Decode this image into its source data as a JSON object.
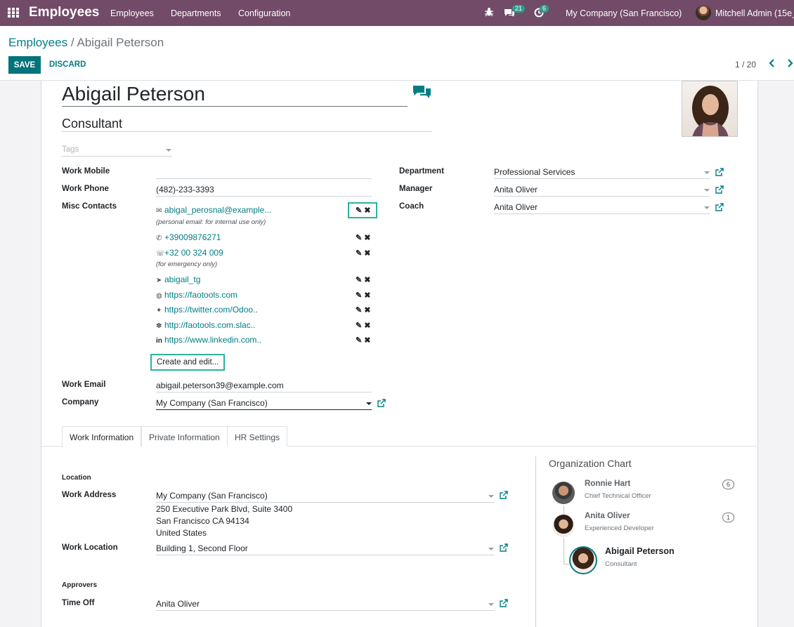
{
  "navbar": {
    "brand": "Employees",
    "menu": [
      "Employees",
      "Departments",
      "Configuration"
    ],
    "messages_count": "21",
    "activities_count": "6",
    "company": "My Company (San Francisco)",
    "user": "Mitchell Admin (15e_"
  },
  "control": {
    "breadcrumb_parent": "Employees",
    "breadcrumb_sep": "/",
    "breadcrumb_current": "Abigail Peterson",
    "save_label": "SAVE",
    "discard_label": "DISCARD",
    "pager": "1 / 20"
  },
  "employee": {
    "name": "Abigail Peterson",
    "job_title": "Consultant",
    "tags_placeholder": "Tags"
  },
  "left_fields": {
    "work_mobile_label": "Work Mobile",
    "work_mobile": "",
    "work_phone_label": "Work Phone",
    "work_phone": "(482)-233-3393",
    "misc_contacts_label": "Misc Contacts",
    "work_email_label": "Work Email",
    "work_email": "abigail.peterson39@example.com",
    "company_label": "Company",
    "company": "My Company (San Francisco)"
  },
  "contacts": [
    {
      "icon": "email-icon",
      "glyph": "✉",
      "value": "abigal_perosnal@example...",
      "note": "(personal email: for internal use only)"
    },
    {
      "icon": "whatsapp-icon",
      "glyph": "✆",
      "value": "+39009876271",
      "note": ""
    },
    {
      "icon": "phone-icon",
      "glyph": "☏",
      "value": "+32 00 324 009",
      "note": "(for emergency only)"
    },
    {
      "icon": "telegram-icon",
      "glyph": "➤",
      "value": "abigail_tg",
      "note": ""
    },
    {
      "icon": "globe-icon",
      "glyph": "◍",
      "value": "https://faotools.com",
      "note": ""
    },
    {
      "icon": "twitter-icon",
      "glyph": "✦",
      "value": "https://twitter.com/Odoo..",
      "note": ""
    },
    {
      "icon": "slack-icon",
      "glyph": "✽",
      "value": "http://faotools.com.slac..",
      "note": ""
    },
    {
      "icon": "linkedin-icon",
      "glyph": "in",
      "value": "https://www.linkedin.com..",
      "note": ""
    }
  ],
  "create_and_edit": "Create and edit...",
  "right_fields": {
    "department_label": "Department",
    "department": "Professional Services",
    "manager_label": "Manager",
    "manager": "Anita Oliver",
    "coach_label": "Coach",
    "coach": "Anita Oliver"
  },
  "tabs": [
    "Work Information",
    "Private Information",
    "HR Settings"
  ],
  "work_info": {
    "location_section": "Location",
    "work_address_label": "Work Address",
    "work_address": "My Company (San Francisco)",
    "address_lines": [
      "250 Executive Park Blvd, Suite 3400",
      "San Francisco CA 94134",
      "United States"
    ],
    "work_location_label": "Work Location",
    "work_location": "Building 1, Second Floor",
    "approvers_section": "Approvers",
    "time_off_label": "Time Off",
    "time_off": "Anita Oliver"
  },
  "org_chart": {
    "title": "Organization Chart",
    "people": [
      {
        "name": "Ronnie Hart",
        "role": "Chief Technical Officer",
        "count": "6"
      },
      {
        "name": "Anita Oliver",
        "role": "Experienced Developer",
        "count": "1"
      },
      {
        "name": "Abigail Peterson",
        "role": "Consultant"
      }
    ]
  },
  "colors": {
    "navbar": "#714b67",
    "primary": "#00737b",
    "link": "#017e84",
    "highlight": "#2bb39d"
  }
}
